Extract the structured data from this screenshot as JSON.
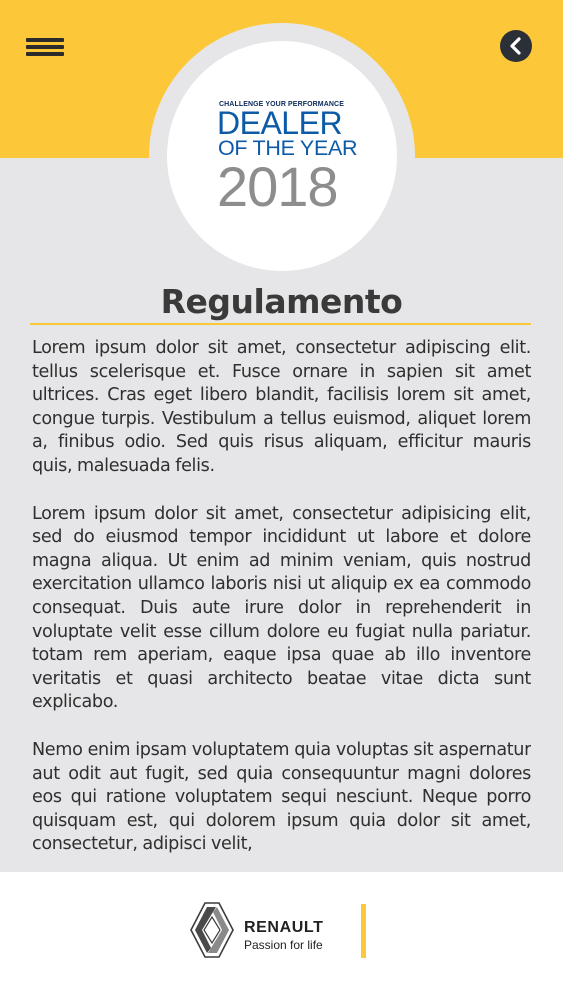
{
  "header": {
    "menu_icon": "hamburger-menu-icon",
    "back_icon": "chevron-left-icon",
    "colors": {
      "bar": "#fcc83a",
      "back_button": "#2b2f38"
    }
  },
  "logo": {
    "tagline": "CHALLENGE YOUR PERFORMANCE",
    "line1": "DEALER",
    "line2": "OF THE YEAR",
    "year": "2018",
    "colors": {
      "primary": "#0d5aa7",
      "year": "#8d8d8d"
    }
  },
  "page": {
    "title": "Regulamento",
    "paragraphs": [
      "Lorem ipsum dolor sit amet, consectetur adipiscing elit.  tellus scelerisque et. Fusce ornare in sapien sit amet ultrices. Cras eget libero blandit, facilisis lorem sit amet, congue turpis. Vestibulum a tellus euismod, aliquet lorem a, finibus odio. Sed quis risus aliquam, efficitur mauris quis, malesuada felis.",
      "Lorem ipsum dolor sit amet, consectetur adipisicing elit, sed do eiusmod tempor incididunt ut labore et dolore magna aliqua. Ut enim ad minim veniam, quis nostrud exercitation ullamco laboris nisi ut aliquip ex ea commodo consequat. Duis aute irure dolor in reprehenderit in voluptate velit esse cillum dolore eu fugiat nulla pariatur. totam rem aperiam, eaque ipsa quae ab illo inventore veritatis et quasi architecto beatae vitae dicta sunt explicabo.",
      "Nemo enim ipsam voluptatem quia voluptas sit aspernatur aut odit aut fugit, sed quia consequuntur magni dolores eos qui ratione voluptatem sequi nesciunt. Neque porro quisquam est, qui dolorem ipsum quia dolor sit amet, consectetur, adipisci velit,"
    ]
  },
  "footer": {
    "brand_name": "RENAULT",
    "brand_tagline": "Passion for life",
    "emblem_icon": "renault-diamond-logo-icon",
    "accent": "#fcc83a"
  }
}
